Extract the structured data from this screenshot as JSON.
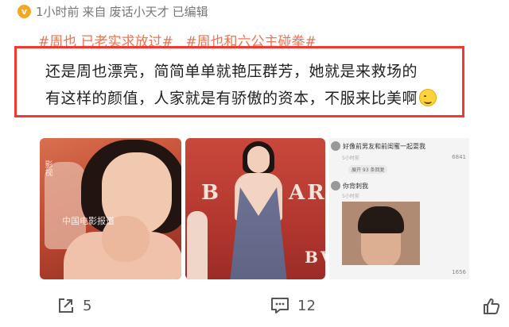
{
  "post": {
    "badge": "v",
    "time": "1小时前",
    "source_prefix": "来自",
    "source_name": "废话小天才",
    "edited": "已编辑",
    "tags": [
      "#周也 已老实求放过#",
      "#周也和六公主碰拳#"
    ],
    "text_line1": "还是周也漂亮，简简单单就艳压群芳，她就是来救场的",
    "text_line2": "有这样的颜值，人家就是有骄傲的资本，不服来比美啊"
  },
  "images": {
    "photo1_watermark": "中国电影报道",
    "photo1_brand": "影视",
    "photo2_text": [
      "B",
      "AR",
      "BV"
    ],
    "photo3": {
      "comment1": "好像前男友和前闺蜜一起耍我",
      "comment1_sub": "5小时前",
      "comment1_count": "6841",
      "reply_pill": "展开 93 条回复",
      "comment2": "你背刺我",
      "comment2_sub": "5小时前",
      "comment2_count": "1656"
    }
  },
  "actions": {
    "share_count": "5",
    "comment_count": "12"
  },
  "colors": {
    "highlight_border": "#ee3a30",
    "tag": "#eb7350",
    "meta": "#777777"
  }
}
